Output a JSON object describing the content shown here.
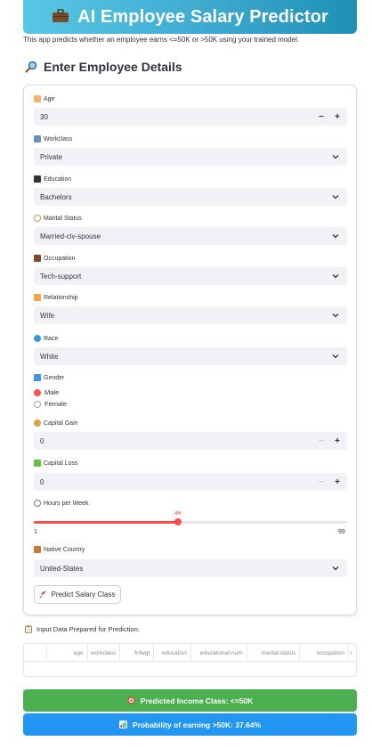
{
  "header": {
    "title": "AI Employee Salary Predictor",
    "subtitle": "This app predicts whether an employee earns <=50K or >50K using your trained model."
  },
  "form": {
    "section_title": "Enter Employee Details",
    "age": {
      "label": "Age",
      "value": "30",
      "minus": "−",
      "plus": "+"
    },
    "workclass": {
      "label": "Workclass",
      "value": "Private"
    },
    "education": {
      "label": "Education",
      "value": "Bachelors"
    },
    "marital_status": {
      "label": "Marital Status",
      "value": "Married-civ-spouse"
    },
    "occupation": {
      "label": "Occupation",
      "value": "Tech-support"
    },
    "relationship": {
      "label": "Relationship",
      "value": "Wife"
    },
    "race": {
      "label": "Race",
      "value": "White"
    },
    "gender": {
      "label": "Gender",
      "options": [
        "Male",
        "Female"
      ],
      "selected": "Male"
    },
    "capital_gain": {
      "label": "Capital Gain",
      "value": "0",
      "minus": "−",
      "plus": "+"
    },
    "capital_loss": {
      "label": "Capital Loss",
      "value": "0",
      "minus": "−",
      "plus": "+"
    },
    "hours_per_week": {
      "label": "Hours per Week",
      "value": 46,
      "min": 1,
      "max": 99,
      "value_text": "46",
      "min_text": "1",
      "max_text": "99"
    },
    "native_country": {
      "label": "Native Country",
      "value": "United-States"
    },
    "submit_label": "Predict Salary Class"
  },
  "prepared": {
    "label": "Input Data Prepared for Prediction:",
    "columns": [
      "age",
      "workclass",
      "fnlwgt",
      "education",
      "educational-num",
      "marital-status",
      "occupation",
      "r"
    ]
  },
  "results": {
    "predicted": "Predicted Income Class: <=50K",
    "probability": "Probability of earning >50K: 37.64%"
  },
  "colors": {
    "accent": "#ff4b4b",
    "success": "#4caf50",
    "info": "#2196f3",
    "banner": "#3aa8cc"
  }
}
